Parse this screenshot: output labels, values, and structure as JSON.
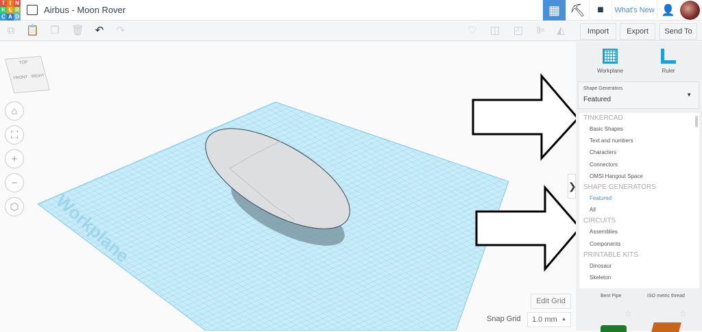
{
  "header": {
    "logo_letters": [
      "T",
      "I",
      "N",
      "K",
      "E",
      "R",
      "C",
      "A",
      "D"
    ],
    "title": "Airbus - Moon Rover",
    "whats_new": "What's New"
  },
  "toolbar": {
    "import": "Import",
    "export": "Export",
    "send_to": "Send To"
  },
  "viewcube": {
    "top": "TOP",
    "front": "FRONT",
    "right": "RIGHT"
  },
  "workplane_label": "Workplane",
  "bottom": {
    "edit_grid": "Edit Grid",
    "snap_grid_label": "Snap Grid",
    "snap_grid_value": "1.0 mm"
  },
  "panel": {
    "workplane": "Workplane",
    "ruler": "Ruler",
    "dropdown_label": "Shape Generators",
    "dropdown_value": "Featured",
    "list": [
      {
        "type": "header",
        "label": "TINKERCAD"
      },
      {
        "type": "item",
        "label": "Basic Shapes"
      },
      {
        "type": "item",
        "label": "Text and numbers"
      },
      {
        "type": "item",
        "label": "Characters"
      },
      {
        "type": "item",
        "label": "Connectors"
      },
      {
        "type": "item",
        "label": "OMSI Hangout Space"
      },
      {
        "type": "header",
        "label": "SHAPE GENERATORS"
      },
      {
        "type": "item",
        "label": "Featured",
        "selected": true
      },
      {
        "type": "item",
        "label": "All"
      },
      {
        "type": "header",
        "label": "CIRCUITS"
      },
      {
        "type": "item",
        "label": "Assemblies"
      },
      {
        "type": "item",
        "label": "Components"
      },
      {
        "type": "header",
        "label": "PRINTABLE KITS"
      },
      {
        "type": "item",
        "label": "Dinosaur"
      },
      {
        "type": "item",
        "label": "Skeleton"
      }
    ],
    "shapes": [
      "Bent Pipe",
      "ISO metric thread"
    ]
  },
  "colors": {
    "accent": "#4a90d9",
    "grid": "#8fd3ee"
  }
}
